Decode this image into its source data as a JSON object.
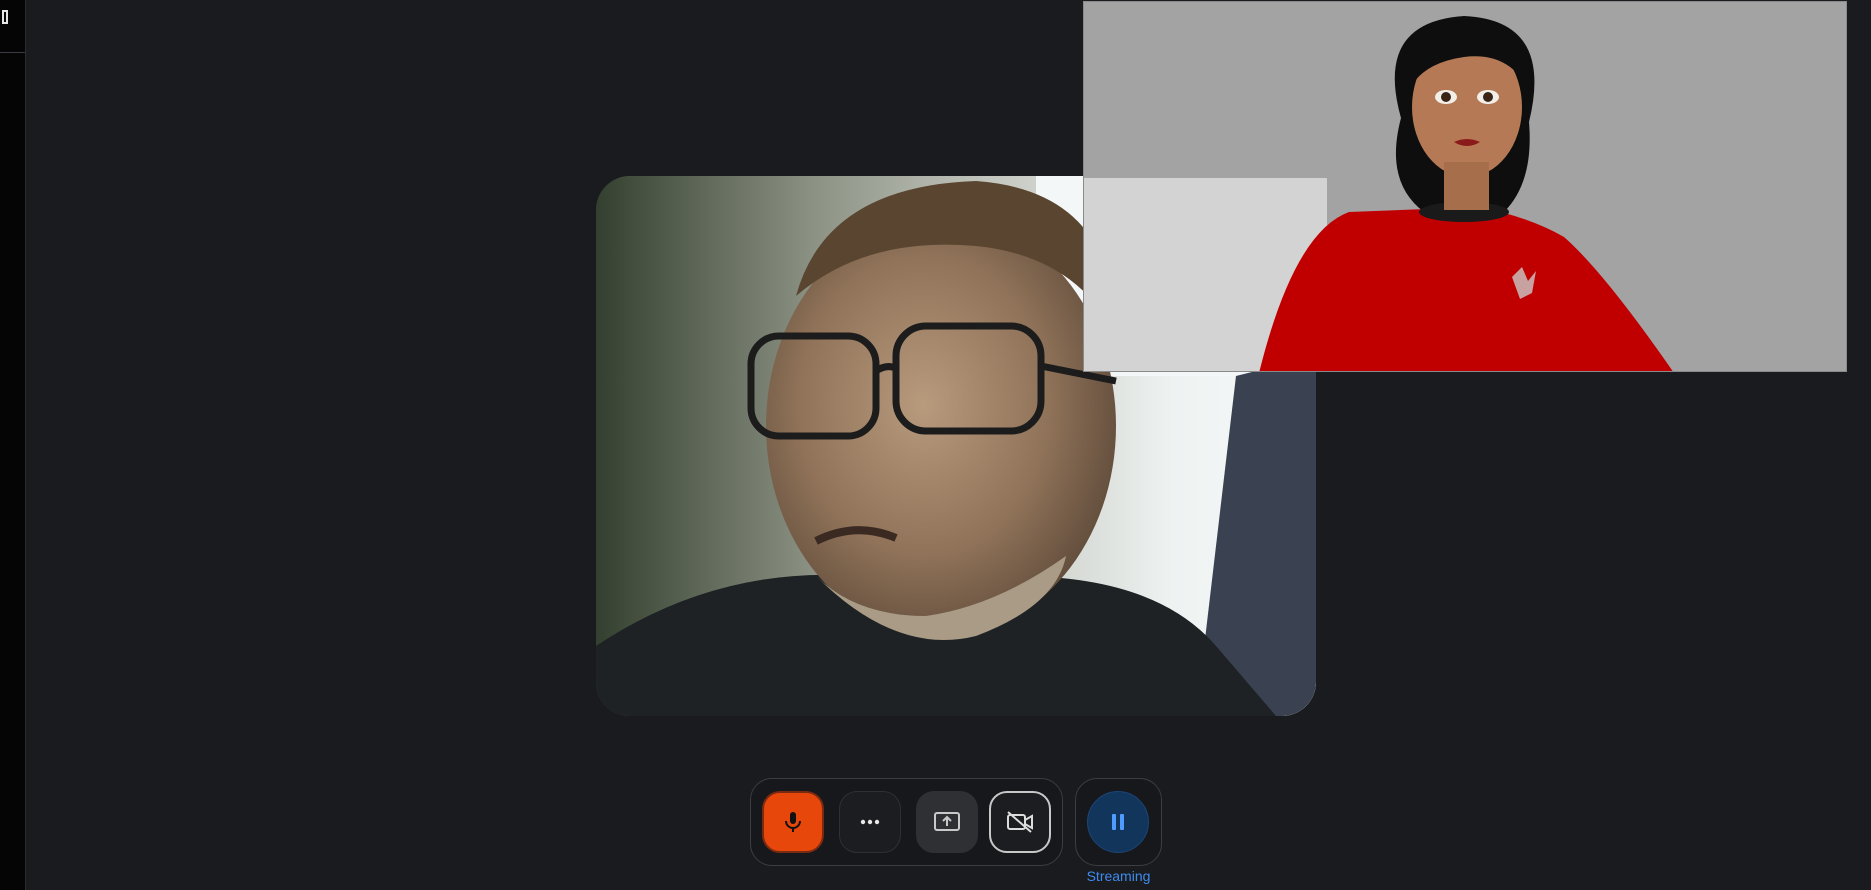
{
  "sidebar": {
    "icon": "panel-icon"
  },
  "videos": {
    "local": {
      "label": ""
    },
    "avatar": {
      "label": ""
    }
  },
  "controls": {
    "mic_icon": "microphone-icon",
    "more_icon": "more-horizontal-icon",
    "share_icon": "screen-share-icon",
    "camera_icon": "camera-off-icon",
    "pause_icon": "pause-icon",
    "streaming_label": "Streaming"
  },
  "colors": {
    "mic_active": "#e8470b",
    "pause_bg": "#12355c",
    "streaming_text": "#3e8bf0"
  }
}
